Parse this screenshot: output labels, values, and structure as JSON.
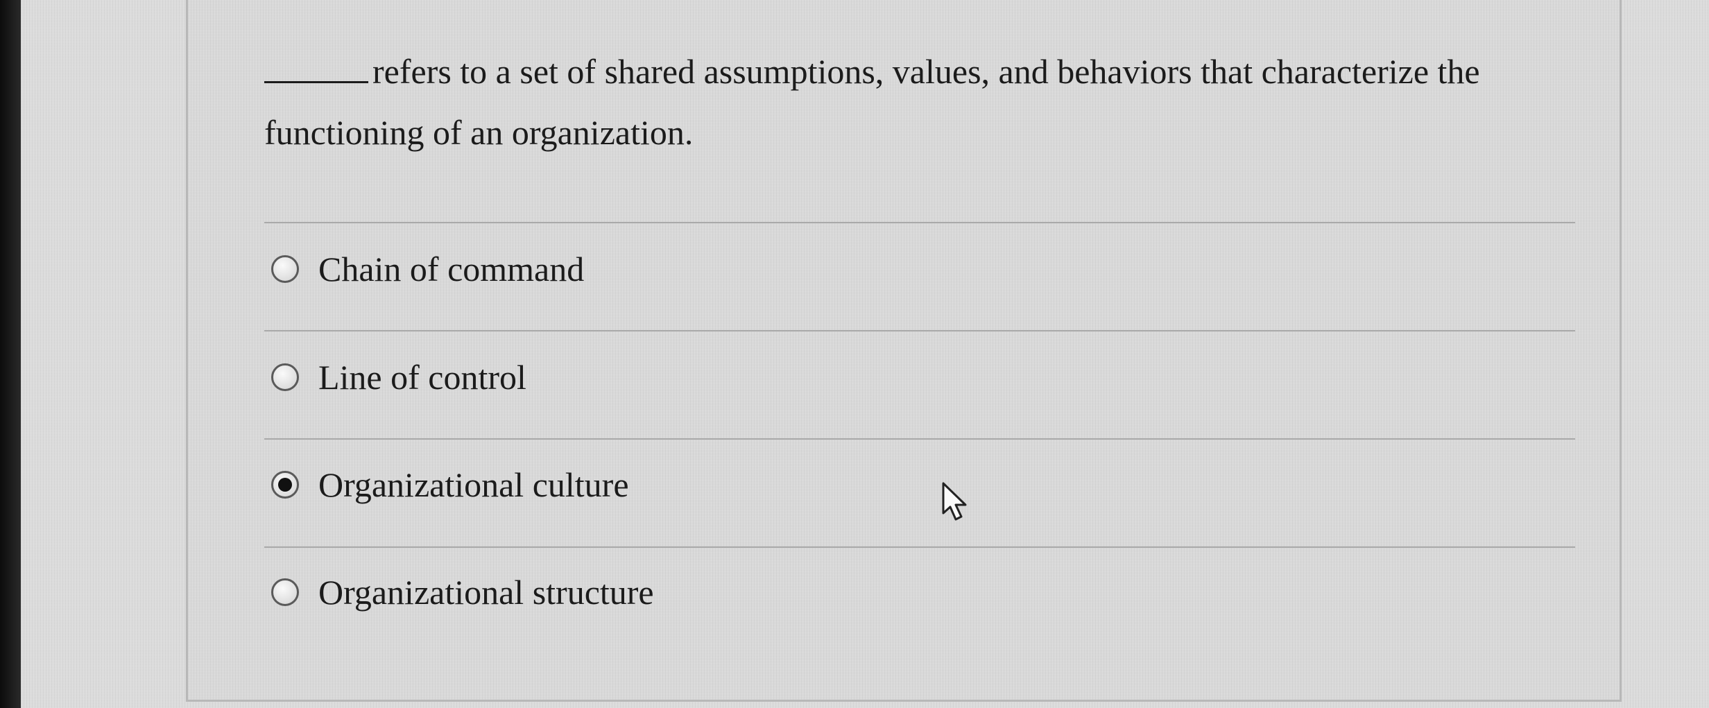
{
  "question": {
    "blank": "_____",
    "text": "refers to a set of shared assumptions, values, and behaviors that characterize the functioning of an organization."
  },
  "options": [
    {
      "label": "Chain of command",
      "selected": false
    },
    {
      "label": "Line of control",
      "selected": false
    },
    {
      "label": "Organizational culture",
      "selected": true
    },
    {
      "label": "Organizational structure",
      "selected": false
    }
  ],
  "icons": {
    "radio_unselected": "radio-empty-icon",
    "radio_selected": "radio-filled-icon",
    "cursor": "mouse-pointer-icon"
  }
}
